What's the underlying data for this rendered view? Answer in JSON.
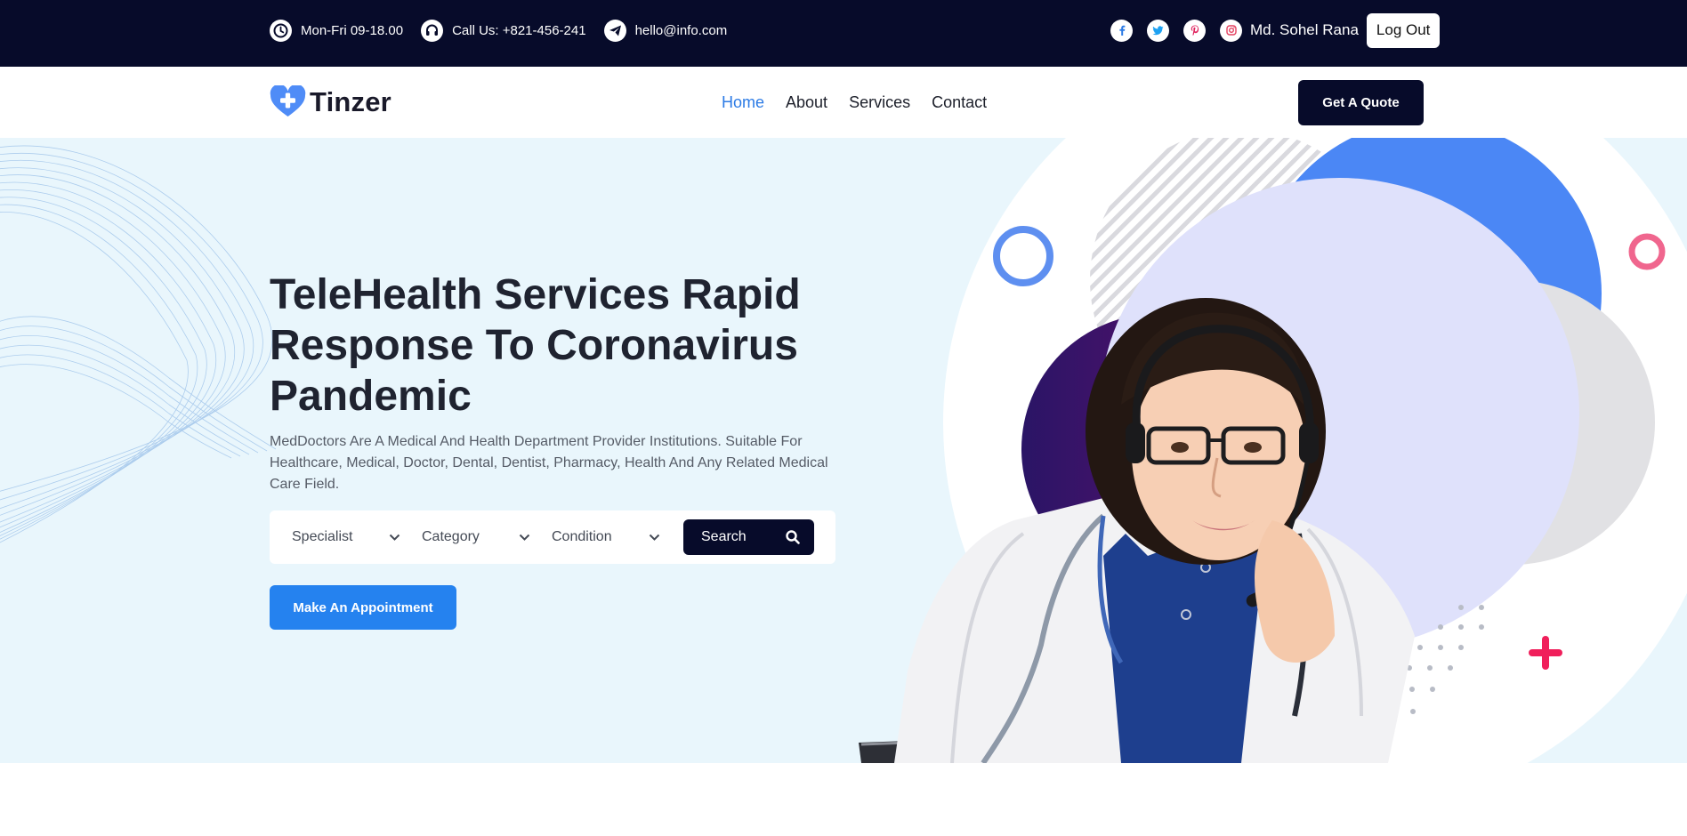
{
  "topbar": {
    "hours": "Mon-Fri 09-18.00",
    "phone": "Call Us: +821-456-241",
    "email": "hello@info.com",
    "social_icons": [
      "facebook-icon",
      "twitter-icon",
      "pinterest-icon",
      "instagram-icon"
    ],
    "user_name": "Md. Sohel Rana",
    "logout_label": "Log Out"
  },
  "nav": {
    "brand": "Tinzer",
    "items": [
      {
        "label": "Home",
        "active": true
      },
      {
        "label": "About",
        "active": false
      },
      {
        "label": "Services",
        "active": false
      },
      {
        "label": "Contact",
        "active": false
      }
    ],
    "cta_label": "Get A Quote"
  },
  "hero": {
    "title": "TeleHealth Services Rapid Response To Coronavirus Pandemic",
    "description": "MedDoctors Are A Medical And Health Department Provider Institutions. Suitable For Healthcare, Medical, Doctor, Dental, Dentist, Pharmacy, Health And Any Related Medical Care Field.",
    "search": {
      "specialist": "Specialist",
      "category": "Category",
      "condition": "Condition",
      "button_label": "Search"
    },
    "appointment_label": "Make An Appointment"
  },
  "colors": {
    "topbar_bg": "#070b2a",
    "accent_blue": "#2582ef",
    "active_link": "#2c7be5",
    "hero_bg": "#e9f6fc",
    "pink_accent": "#f0336b"
  }
}
